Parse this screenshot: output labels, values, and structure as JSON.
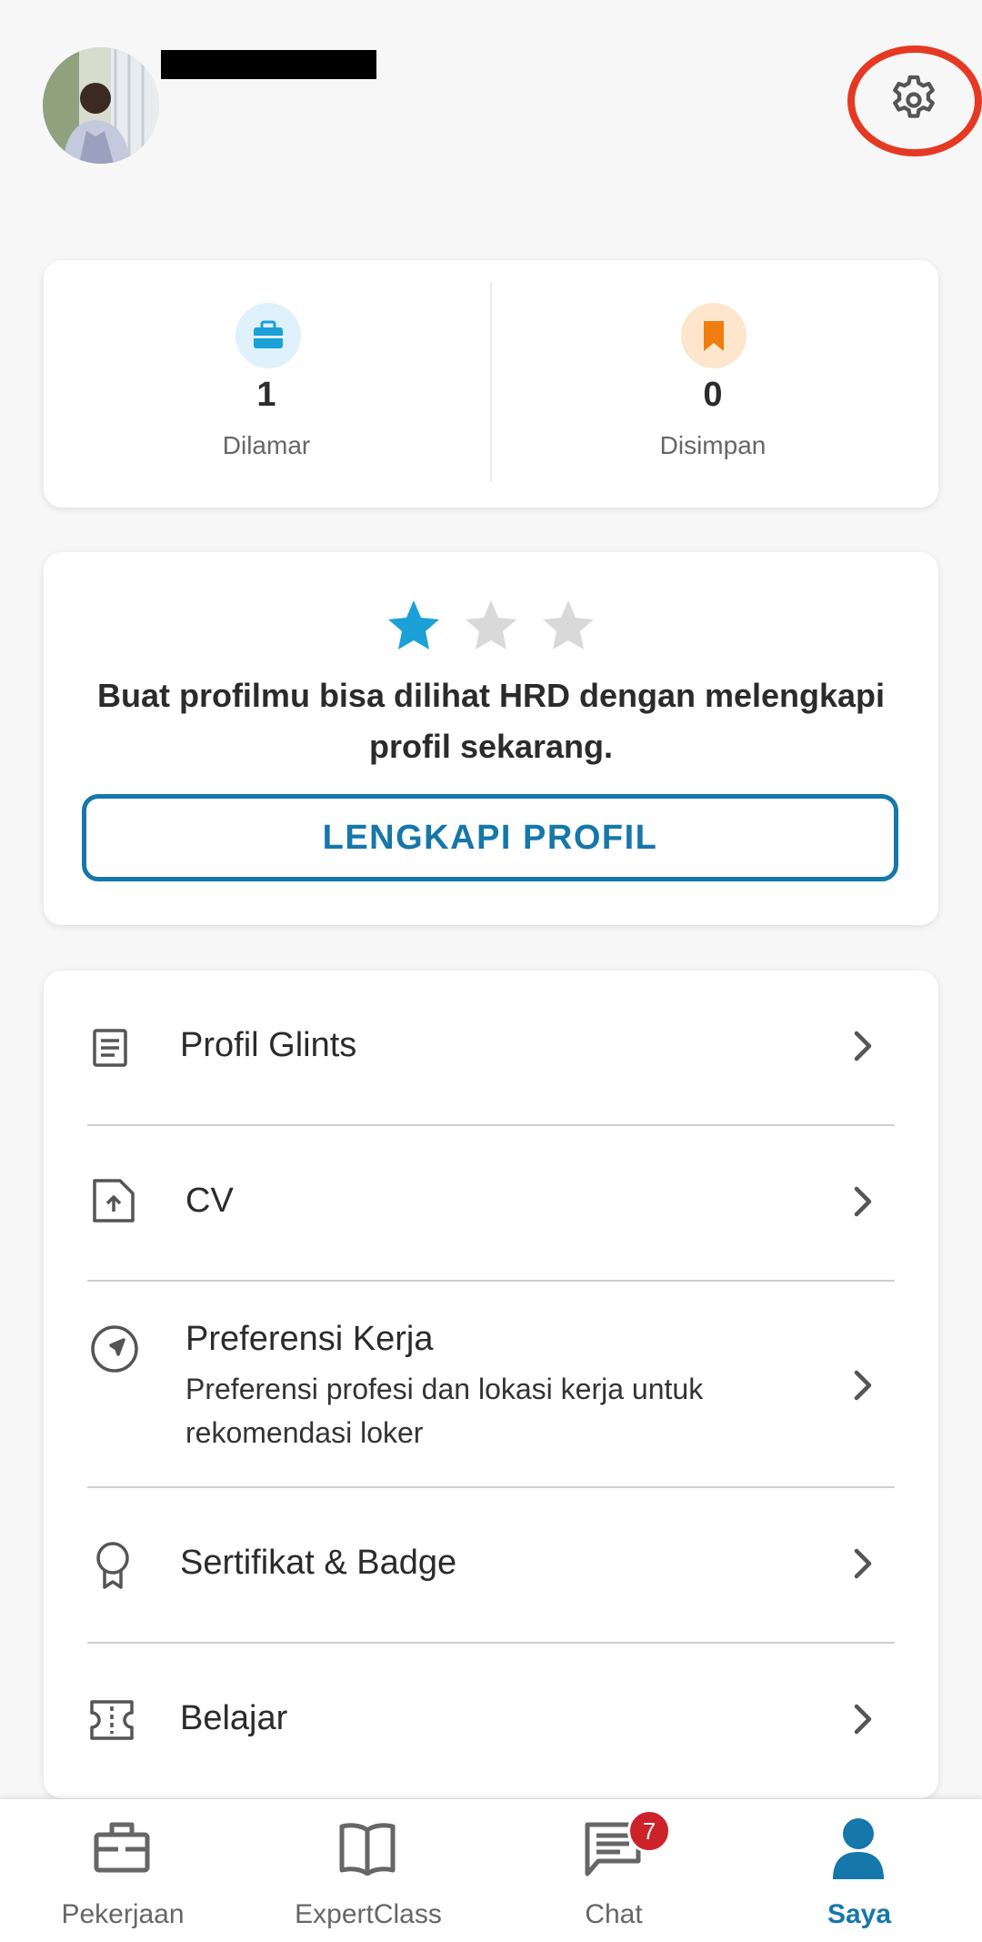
{
  "header": {
    "settings_icon": "gear-icon",
    "highlight_color": "#e53923"
  },
  "stats": {
    "applied": {
      "value": "1",
      "label": "Dilamar",
      "icon": "briefcase-icon",
      "color": "#1ba0d8"
    },
    "saved": {
      "value": "0",
      "label": "Disimpan",
      "icon": "bookmark-icon",
      "color": "#ef7d10"
    }
  },
  "profile_completion": {
    "stars_filled": 1,
    "stars_total": 3,
    "message": "Buat profilmu bisa dilihat HRD dengan melengkapi profil sekarang.",
    "button_label": "LENGKAPI PROFIL"
  },
  "menu": {
    "items": [
      {
        "title": "Profil Glints",
        "icon": "document-icon"
      },
      {
        "title": "CV",
        "icon": "file-upload-icon"
      },
      {
        "title": "Preferensi Kerja",
        "subtitle": "Preferensi profesi dan lokasi kerja untuk rekomendasi loker",
        "icon": "navigation-icon"
      },
      {
        "title": "Sertifikat & Badge",
        "icon": "award-icon"
      },
      {
        "title": "Belajar",
        "icon": "ticket-icon"
      }
    ]
  },
  "bottom_nav": {
    "items": [
      {
        "label": "Pekerjaan",
        "icon": "briefcase-icon"
      },
      {
        "label": "ExpertClass",
        "icon": "book-icon"
      },
      {
        "label": "Chat",
        "icon": "chat-icon",
        "badge": "7"
      },
      {
        "label": "Saya",
        "icon": "person-icon",
        "active": true
      }
    ],
    "active_color": "#1577aa"
  }
}
